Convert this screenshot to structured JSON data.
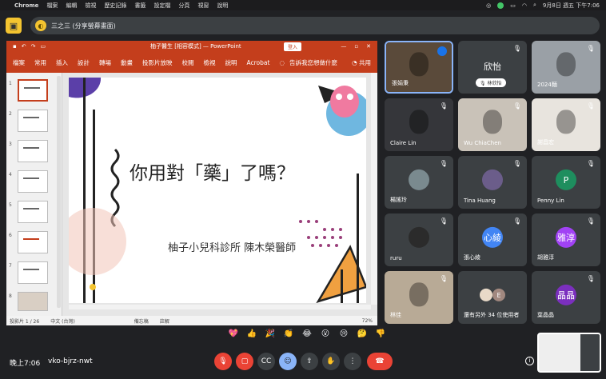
{
  "menubar": {
    "app": "Chrome",
    "menus": [
      "檔案",
      "編輯",
      "檢視",
      "歷史記錄",
      "書籤",
      "設定檔",
      "分頁",
      "視窗",
      "說明"
    ],
    "clock": "9月8日 週五 下午7:06"
  },
  "meet": {
    "presenting_label": "三之三 (分享螢幕畫面)",
    "time": "晚上7:06",
    "meeting_code": "vko-bjrz-nwt"
  },
  "ppt": {
    "doc_title": "柚子醫生 [相容模式] — PowerPoint",
    "login": "登入",
    "tabs": [
      "檔案",
      "常用",
      "插入",
      "設計",
      "轉場",
      "動畫",
      "投影片放映",
      "校閱",
      "檢視",
      "說明",
      "Acrobat"
    ],
    "tell_me": "告訴我您想做什麼",
    "share": "共用",
    "slide_title": "你用對「藥」了嗎？",
    "slide_subtitle": "柚子小兒科診所 陳木榮醫師",
    "status": {
      "slide_count": "投影片 1 / 26",
      "language": "中文 (台灣)",
      "notes": "備忘稿",
      "comments": "註解",
      "zoom": "72%"
    },
    "thumb_numbers": [
      "1",
      "2",
      "3",
      "4",
      "5",
      "6",
      "7",
      "8"
    ]
  },
  "participants": [
    {
      "name": "張娟秉",
      "kind": "video",
      "color": "#5a4a3a"
    },
    {
      "name": "欣怡",
      "kind": "text",
      "badge": "林欣怡"
    },
    {
      "name": "2024麵",
      "kind": "video",
      "color": "#9aa0a6"
    },
    {
      "name": "Claire Lin",
      "kind": "video",
      "color": "#35363a"
    },
    {
      "name": "Wu ChiaChen",
      "kind": "video",
      "color": "#c9c2b8"
    },
    {
      "name": "謝昌宏",
      "kind": "video",
      "color": "#e8e4de"
    },
    {
      "name": "楊謠玲",
      "kind": "avatar",
      "color": "#7a8a8f",
      "initial": ""
    },
    {
      "name": "Tina Huang",
      "kind": "avatar",
      "color": "#6b5d8a",
      "initial": ""
    },
    {
      "name": "Penny Lin",
      "kind": "avatar",
      "color": "#1e8e5e",
      "initial": "P"
    },
    {
      "name": "ruru",
      "kind": "avatar",
      "color": "#2b2b2b",
      "initial": ""
    },
    {
      "name": "張心綾",
      "kind": "avatar",
      "color": "#4285f4",
      "initial": "心綾"
    },
    {
      "name": "胡雅淳",
      "kind": "avatar",
      "color": "#a142f4",
      "initial": "雅淳"
    },
    {
      "name": "林佳",
      "kind": "video",
      "color": "#b8aa96"
    },
    {
      "name": "還有另外 34 位使用者",
      "kind": "others",
      "initial": "E"
    },
    {
      "name": "葉晶晶",
      "kind": "avatar",
      "color": "#7b2fbe",
      "initial": "晶晶"
    }
  ],
  "reactions": [
    "💖",
    "👍",
    "🎉",
    "👏",
    "😂",
    "😮",
    "😢",
    "🤔",
    "👎"
  ],
  "colors": {
    "ppt_accent": "#c43e1c",
    "meet_bg": "#202124",
    "end_call": "#ea4335"
  }
}
